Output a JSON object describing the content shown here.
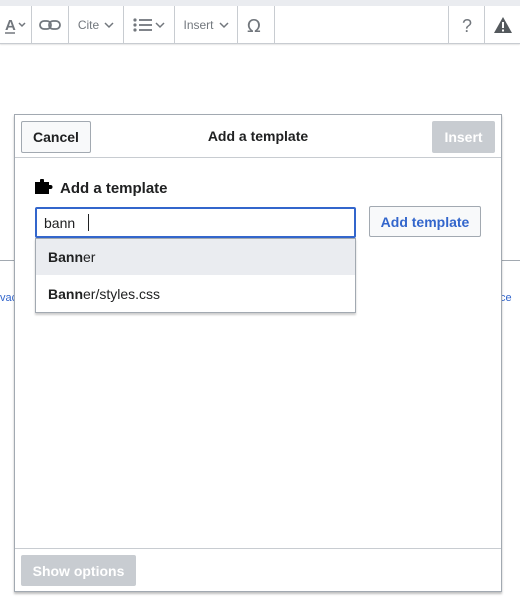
{
  "toolbar": {
    "cite_label": "Cite",
    "insert_label": "Insert",
    "icons": [
      "text-style-icon",
      "link-icon",
      "cite-icon",
      "list-icon",
      "insert-icon",
      "special-character-icon",
      "help-icon",
      "warning-icon"
    ]
  },
  "page": {
    "left_link_fragment": "vac",
    "right_link_fragment": "ce"
  },
  "dialog": {
    "title": "Add a template",
    "cancel_label": "Cancel",
    "insert_label": "Insert",
    "section_title": "Add a template",
    "search": {
      "value": "bann"
    },
    "add_template_label": "Add template",
    "suggestions": [
      {
        "match": "Bann",
        "rest": "er",
        "highlighted": true
      },
      {
        "match": "Bann",
        "rest": "er/styles.css",
        "highlighted": false
      }
    ],
    "show_options_label": "Show options"
  },
  "colors": {
    "accent": "#3366cc",
    "border": "#a2a9b1",
    "disabled_bg": "#c8ccd1",
    "highlight_bg": "#eaecf0"
  }
}
